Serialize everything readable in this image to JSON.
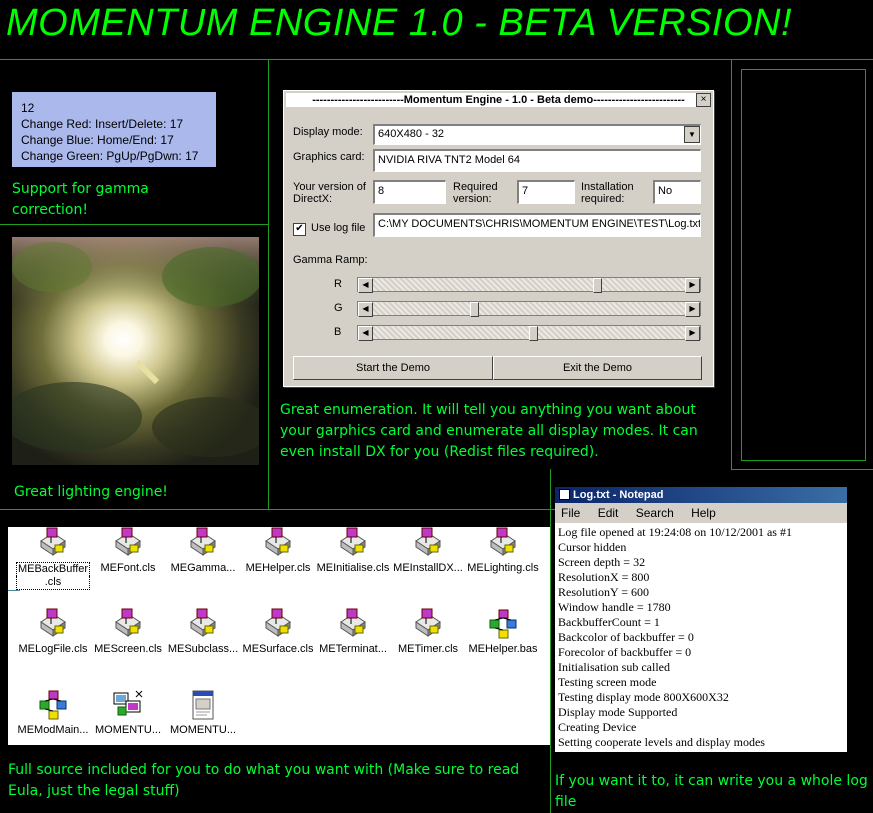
{
  "page_title": "MOMENTUM ENGINE 1.0 - BETA VERSION!",
  "gamma_panel": {
    "lines": [
      "12",
      "Change Red: Insert/Delete: 17",
      "Change Blue: Home/End: 17",
      "Change Green: PgUp/PgDwn: 17"
    ]
  },
  "captions": {
    "gamma": "Support for gamma correction!",
    "lighting": "Great lighting engine!",
    "enumeration": "Great enumeration. It will tell you anything you want about your garphics card and enumerate all display modes. It can even install DX for you (Redist files required).",
    "source": "Full source included for you to do what you want with (Make sure to read Eula, just the legal stuff)",
    "logfile": "If you want it to, it can write you a whole log file"
  },
  "dialog": {
    "title": "-------------------------Momentum Engine - 1.0 - Beta demo-------------------------",
    "close_label": "×",
    "display_mode_label": "Display mode:",
    "display_mode_value": "640X480 - 32",
    "graphics_card_label": "Graphics card:",
    "graphics_card_value": "NVIDIA RIVA TNT2 Model 64",
    "your_version_label_1": "Your version of",
    "your_version_label_2": "DirectX:",
    "your_version_value": "8",
    "required_version_label_1": "Required",
    "required_version_label_2": "version:",
    "required_version_value": "7",
    "install_required_label_1": "Installation",
    "install_required_label_2": "required:",
    "install_required_value": "No",
    "use_log_label": "Use log file",
    "use_log_checked": "✔",
    "log_path_value": "C:\\MY DOCUMENTS\\CHRIS\\MOMENTUM ENGINE\\TEST\\Log.txt",
    "gamma_ramp_label": "Gamma Ramp:",
    "r_label": "R",
    "g_label": "G",
    "b_label": "B",
    "r_level": 0.72,
    "g_level": 0.32,
    "b_level": 0.51,
    "start_label": "Start the Demo",
    "exit_label": "Exit the Demo"
  },
  "files": [
    {
      "name": "MEBackBuffer",
      "name2": ".cls",
      "icon": "vb-class-icon"
    },
    {
      "name": "MEFont.cls",
      "icon": "vb-class-icon"
    },
    {
      "name": "MEGamma...",
      "icon": "vb-class-icon"
    },
    {
      "name": "MEHelper.cls",
      "icon": "vb-class-icon"
    },
    {
      "name": "MEInitialise.cls",
      "icon": "vb-class-icon"
    },
    {
      "name": "MEInstallDX...",
      "icon": "vb-class-icon"
    },
    {
      "name": "MELighting.cls",
      "icon": "vb-class-icon"
    },
    {
      "name": "MELogFile.cls",
      "icon": "vb-class-icon"
    },
    {
      "name": "MEScreen.cls",
      "icon": "vb-class-icon"
    },
    {
      "name": "MESubclass...",
      "icon": "vb-class-icon"
    },
    {
      "name": "MESurface.cls",
      "icon": "vb-class-icon"
    },
    {
      "name": "METerminat...",
      "icon": "vb-class-icon"
    },
    {
      "name": "METimer.cls",
      "icon": "vb-class-icon"
    },
    {
      "name": "MEHelper.bas",
      "icon": "vb-module-icon"
    },
    {
      "name": "MEModMain...",
      "icon": "vb-module-icon"
    },
    {
      "name": "MOMENTU...",
      "icon": "vb-project-icon"
    },
    {
      "name": "MOMENTU...",
      "icon": "text-document-icon"
    }
  ],
  "notepad": {
    "title": "Log.txt - Notepad",
    "menu": [
      "File",
      "Edit",
      "Search",
      "Help"
    ],
    "lines": [
      "Log file opened at 19:24:08 on 10/12/2001 as #1",
      "Cursor hidden",
      "Screen depth = 32",
      "ResolutionX = 800",
      "ResolutionY = 600",
      "Window handle = 1780",
      "BackbufferCount = 1",
      "Backcolor of backbuffer = 0",
      "Forecolor of backbuffer  = 0",
      "Initialisation sub called",
      "Testing screen mode",
      "Testing display mode 800X600X32",
      "Display mode Supported",
      "Creating Device",
      "Setting cooperate levels and display modes"
    ]
  }
}
